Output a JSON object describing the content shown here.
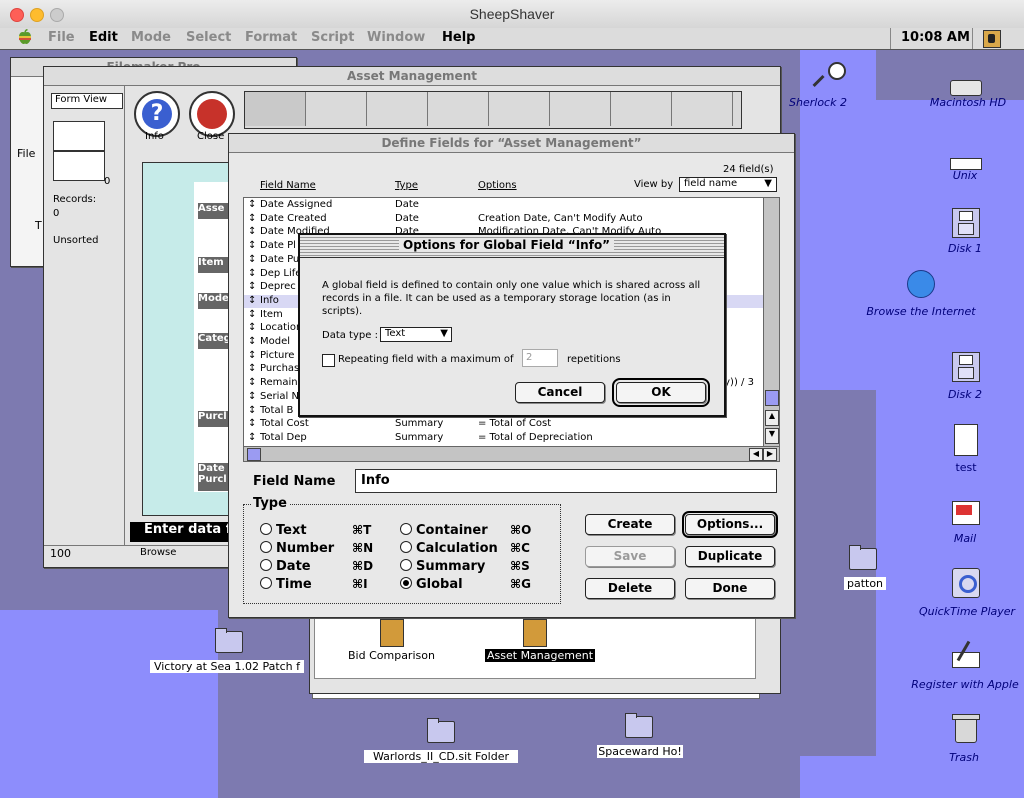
{
  "host": {
    "title": "SheepShaver"
  },
  "menubar": {
    "items": [
      "File",
      "Edit",
      "Mode",
      "Select",
      "Format",
      "Script",
      "Window",
      "Help"
    ],
    "dim": [
      true,
      false,
      true,
      true,
      true,
      true,
      true,
      false
    ],
    "clock": "10:08 AM"
  },
  "back_window": {
    "title": "Filemaker Pro",
    "label": "File",
    "t": "T"
  },
  "asset_window": {
    "title": "Asset Management",
    "view_menu": "Form View",
    "info_label": "Info",
    "close_label": "Close",
    "book_number": "0",
    "records_label": "Records:",
    "records_value": "0",
    "sort_status": "Unsorted",
    "zoom": "100",
    "mode": "Browse",
    "status_text": "Enter data fo",
    "form_labels": [
      "Asse",
      "Item",
      "Mode",
      "Categ",
      "Purcl",
      "Date Purcl"
    ],
    "layout_icons": [
      {
        "label": "Bid Comparison",
        "selected": false
      },
      {
        "label": "Asset Management",
        "selected": true
      }
    ]
  },
  "define_fields": {
    "title": "Define Fields for “Asset Management”",
    "count": "24 field(s)",
    "headers": {
      "name": "Field Name",
      "type": "Type",
      "options": "Options"
    },
    "view_by_label": "View by",
    "view_by_value": "field name",
    "rows": [
      {
        "name": "Date Assigned",
        "type": "Date",
        "options": ""
      },
      {
        "name": "Date Created",
        "type": "Date",
        "options": "Creation Date, Can't Modify Auto"
      },
      {
        "name": "Date Modified",
        "type": "Date",
        "options": "Modification Date, Can't Modify Auto"
      },
      {
        "name": "Date Pl",
        "type": "",
        "options": ""
      },
      {
        "name": "Date Pu",
        "type": "",
        "options": ""
      },
      {
        "name": "Dep Life",
        "type": "",
        "options": ""
      },
      {
        "name": "Deprec",
        "type": "",
        "options": ""
      },
      {
        "name": "Info",
        "type": "",
        "options": ""
      },
      {
        "name": "Item",
        "type": "",
        "options": ""
      },
      {
        "name": "Location",
        "type": "",
        "options": ""
      },
      {
        "name": "Model",
        "type": "",
        "options": ""
      },
      {
        "name": "Picture",
        "type": "",
        "options": ""
      },
      {
        "name": "Purchas",
        "type": "",
        "options": ""
      },
      {
        "name": "Remain",
        "type": "",
        "options": "ay)) / 3"
      },
      {
        "name": "Serial N",
        "type": "",
        "options": ""
      },
      {
        "name": "Total B",
        "type": "",
        "options": ""
      },
      {
        "name": "Total Cost",
        "type": "Summary",
        "options": "= Total of Cost"
      },
      {
        "name": "Total Dep",
        "type": "Summary",
        "options": "= Total of Depreciation"
      }
    ],
    "field_name_label": "Field Name",
    "field_name_value": "Info",
    "type_legend": "Type",
    "types": [
      {
        "label": "Text",
        "key": "⌘T",
        "checked": false
      },
      {
        "label": "Number",
        "key": "⌘N",
        "checked": false
      },
      {
        "label": "Date",
        "key": "⌘D",
        "checked": false
      },
      {
        "label": "Time",
        "key": "⌘I",
        "checked": false
      },
      {
        "label": "Container",
        "key": "⌘O",
        "checked": false
      },
      {
        "label": "Calculation",
        "key": "⌘C",
        "checked": false
      },
      {
        "label": "Summary",
        "key": "⌘S",
        "checked": false
      },
      {
        "label": "Global",
        "key": "⌘G",
        "checked": true
      }
    ],
    "buttons": {
      "create": "Create",
      "options": "Options...",
      "save": "Save",
      "duplicate": "Duplicate",
      "delete": "Delete",
      "done": "Done"
    }
  },
  "global_dialog": {
    "title": "Options for Global Field “Info”",
    "description": "A global field is defined to contain only one value which is shared across all records in a file.  It can be used as a temporary storage location (as in scripts).",
    "data_type_label": "Data type :",
    "data_type_value": "Text",
    "repeat_label": "Repeating field with a maximum of",
    "repeat_value": "2",
    "repeat_suffix": "repetitions",
    "cancel": "Cancel",
    "ok": "OK"
  },
  "desktop_icons": [
    {
      "label": "Sherlock 2",
      "icon": "sherlock-icon"
    },
    {
      "label": "Macintosh HD",
      "icon": "hard-disk-icon"
    },
    {
      "label": "Unix",
      "icon": "drive-icon"
    },
    {
      "label": "Disk 1",
      "icon": "disk-icon"
    },
    {
      "label": "Browse the Internet",
      "icon": "globe-icon"
    },
    {
      "label": "Disk 2",
      "icon": "disk-icon"
    },
    {
      "label": "test",
      "icon": "document-icon"
    },
    {
      "label": "Mail",
      "icon": "mail-icon"
    },
    {
      "label": "patton",
      "icon": "folder-icon"
    },
    {
      "label": "QuickTime Player",
      "icon": "quicktime-icon"
    },
    {
      "label": "Register with Apple",
      "icon": "register-icon"
    },
    {
      "label": "Trash",
      "icon": "trash-icon"
    },
    {
      "label": "Victory at Sea 1.02 Patch f",
      "icon": "folder-icon"
    },
    {
      "label": "Warlords_II_CD.sit Folder",
      "icon": "folder-icon"
    },
    {
      "label": "Spaceward Ho!",
      "icon": "folder-icon"
    }
  ]
}
